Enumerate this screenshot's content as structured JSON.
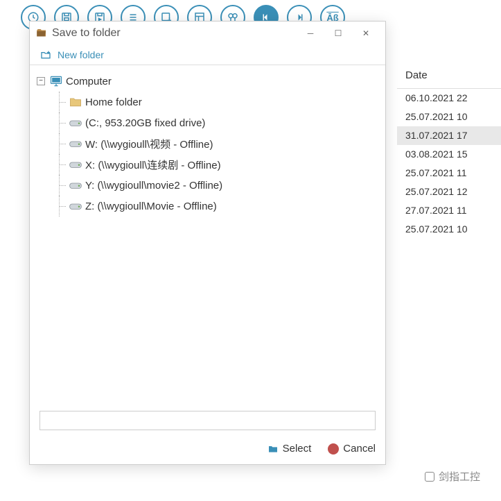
{
  "toolbar": {
    "icons": [
      "clock",
      "save",
      "save-as",
      "list",
      "disk-down",
      "layout",
      "binoc",
      "prev",
      "next",
      "ab"
    ]
  },
  "bg": {
    "header": "Date",
    "rows": [
      {
        "t": "06.10.2021 22",
        "sel": false
      },
      {
        "t": "25.07.2021 10",
        "sel": false
      },
      {
        "t": "31.07.2021 17",
        "sel": true
      },
      {
        "t": "03.08.2021 15",
        "sel": false
      },
      {
        "t": "25.07.2021 11",
        "sel": false
      },
      {
        "t": "25.07.2021 12",
        "sel": false
      },
      {
        "t": "27.07.2021 11",
        "sel": false
      },
      {
        "t": "25.07.2021 10",
        "sel": false
      }
    ]
  },
  "dialog": {
    "title": "Save to folder",
    "newfolder": "New folder",
    "tree": {
      "root": "Computer",
      "items": [
        {
          "icon": "folder",
          "label": "Home folder"
        },
        {
          "icon": "drive",
          "label": " (C:, 953.20GB fixed drive)"
        },
        {
          "icon": "drive",
          "label": "W: (\\\\wygioull\\视频 - Offline)"
        },
        {
          "icon": "drive",
          "label": "X: (\\\\wygioull\\连续剧 - Offline)"
        },
        {
          "icon": "drive",
          "label": "Y: (\\\\wygioull\\movie2 - Offline)"
        },
        {
          "icon": "drive",
          "label": "Z: (\\\\wygioull\\Movie - Offline)"
        }
      ]
    },
    "path": "",
    "select": "Select",
    "cancel": "Cancel"
  },
  "watermark": "剑指工控"
}
